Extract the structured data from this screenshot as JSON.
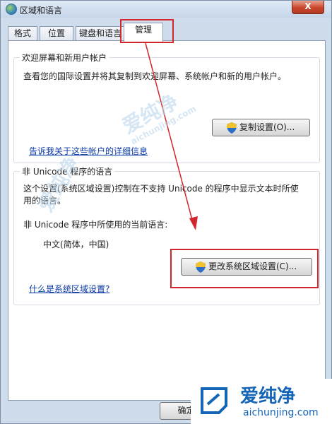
{
  "window": {
    "title": "区域和语言",
    "close_label": "X"
  },
  "tabs": [
    {
      "label": "格式"
    },
    {
      "label": "位置"
    },
    {
      "label": "键盘和语言"
    },
    {
      "label": "管理",
      "active": true
    }
  ],
  "welcome_group": {
    "title": "欢迎屏幕和新用户帐户",
    "description": "查看您的国际设置并将其复制到欢迎屏幕、系统帐户和新的用户帐户。",
    "copy_button": "复制设置(O)...",
    "link": "告诉我关于这些帐户的详细信息"
  },
  "unicode_group": {
    "title": "非 Unicode 程序的语言",
    "description_line1": "这个设置(系统区域设置)控制在不支持 Unicode 的程序中显示文本时所使",
    "description_line2": "用的语言。",
    "current_label": "非 Unicode 程序中所使用的当前语言:",
    "current_value": "中文(简体，中国)",
    "change_button": "更改系统区域设置(C)...",
    "link": "什么是系统区域设置?"
  },
  "footer": {
    "ok_button": "确定"
  },
  "watermark": {
    "brand": "爱纯净",
    "url": "aichunjing.com"
  },
  "colors": {
    "annotation": "#d3272f",
    "link": "#0a3aa8",
    "brand": "#1565b6"
  }
}
